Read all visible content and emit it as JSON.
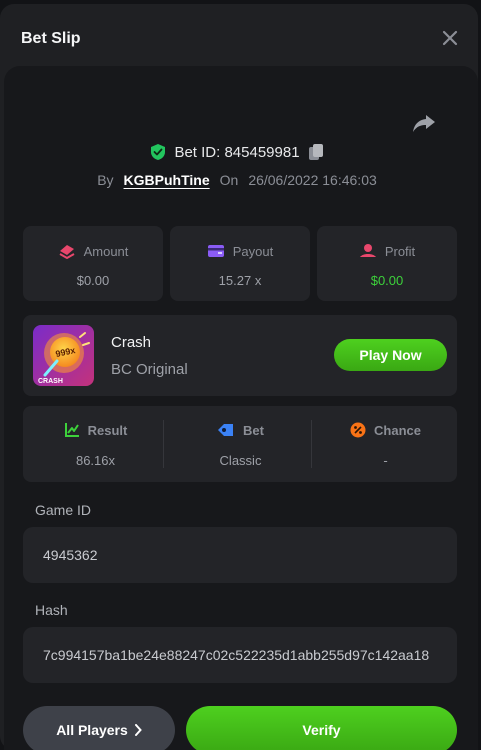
{
  "dialog": {
    "title": "Bet Slip",
    "close_icon": "close-icon",
    "share_icon": "share-icon"
  },
  "bet": {
    "id_label": "Bet ID: 845459981",
    "by_label": "By",
    "user": "KGBPuhTine",
    "on_label": "On",
    "date": "26/06/2022 16:46:03"
  },
  "stats": [
    {
      "label": "Amount",
      "value": "$0.00",
      "icon": "amount-icon",
      "color": "#e8476c"
    },
    {
      "label": "Payout",
      "value": "15.27 x",
      "icon": "payout-icon",
      "color": "#8b5cf6"
    },
    {
      "label": "Profit",
      "value": "$0.00",
      "icon": "profit-icon",
      "color": "#e8476c"
    }
  ],
  "game": {
    "name": "Crash",
    "provider": "BC Original",
    "play_label": "Play Now",
    "thumb_badge": "999x",
    "thumb_label": "CRASH"
  },
  "result": [
    {
      "label": "Result",
      "value": "86.16x",
      "icon": "result-chart-icon",
      "color": "#3dd13b"
    },
    {
      "label": "Bet",
      "value": "Classic",
      "icon": "bet-tag-icon",
      "color": "#3b82f6"
    },
    {
      "label": "Chance",
      "value": "-",
      "icon": "percent-icon",
      "color": "#f97316"
    }
  ],
  "game_id": {
    "label": "Game ID",
    "value": "4945362"
  },
  "hash": {
    "label": "Hash",
    "value": "7c994157ba1be24e88247c02c522235d1abb255d97c142aa18"
  },
  "actions": {
    "all_players_label": "All Players",
    "verify_label": "Verify"
  },
  "colors": {
    "accent_green": "#3dd13b",
    "verified_green": "#22c55e"
  }
}
